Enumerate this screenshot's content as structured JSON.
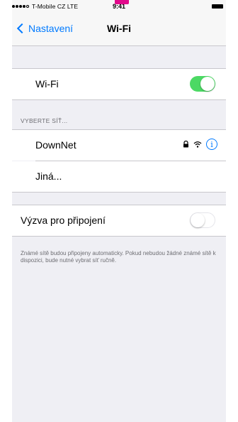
{
  "status_bar": {
    "carrier": "T-Mobile CZ  LTE",
    "time": "9:41"
  },
  "nav": {
    "back_label": "Nastavení",
    "title": "Wi-Fi"
  },
  "wifi": {
    "label": "Wi-Fi",
    "enabled": true
  },
  "networks_section": {
    "header": "VYBERTE SÍŤ...",
    "items": [
      {
        "name": "DownNet",
        "icons": [
          "lock-icon",
          "wifi-signal-icon",
          "info-icon"
        ]
      },
      {
        "name": "Jiná..."
      }
    ]
  },
  "ask_to_join": {
    "label": "Výzva pro připojení",
    "enabled": false,
    "footnote": "Známé sítě budou připojeny automaticky. Pokud nebudou žádné známé sítě k dispozici, bude nutné vybrat síť ručně."
  },
  "colors": {
    "accent": "#007aff",
    "toggle_on": "#4cd964",
    "grouped_background": "#efeff4",
    "brand_tab": "#e10a8b"
  }
}
